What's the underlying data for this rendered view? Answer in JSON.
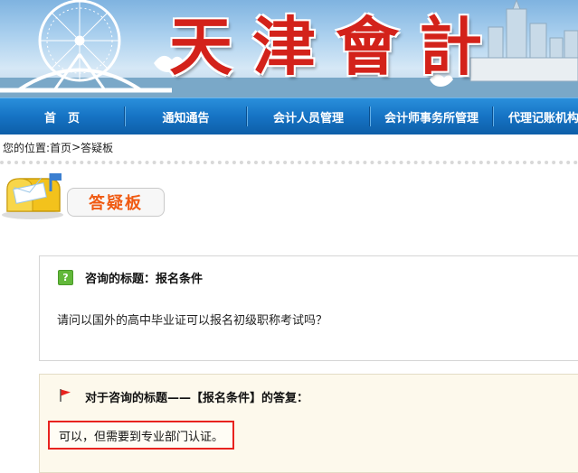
{
  "banner": {
    "title_chars": [
      "天",
      "津",
      "會",
      "計"
    ]
  },
  "nav": {
    "items": [
      {
        "label": "首　页"
      },
      {
        "label": "通知通告"
      },
      {
        "label": "会计人员管理"
      },
      {
        "label": "会计师事务所管理"
      },
      {
        "label": "代理记账机构管"
      }
    ]
  },
  "breadcrumb": {
    "prefix": "您的位置:",
    "home": "首页",
    "separator": ">",
    "current": "答疑板"
  },
  "board": {
    "tab_label": "答疑板",
    "icon": "mailbox-icon"
  },
  "question": {
    "icon": "question-icon",
    "title": "咨询的标题：报名条件",
    "body": "请问以国外的高中毕业证可以报名初级职称考试吗？"
  },
  "answer": {
    "icon": "red-flag-icon",
    "title": "对于咨询的标题——【报名条件】的答复：",
    "body": "可以，但需要到专业部门认证。"
  },
  "colors": {
    "nav_blue": "#1673c4",
    "title_red": "#d3221a",
    "tab_orange": "#f05a12",
    "highlight_red": "#e8231f",
    "question_green": "#62b83a"
  }
}
